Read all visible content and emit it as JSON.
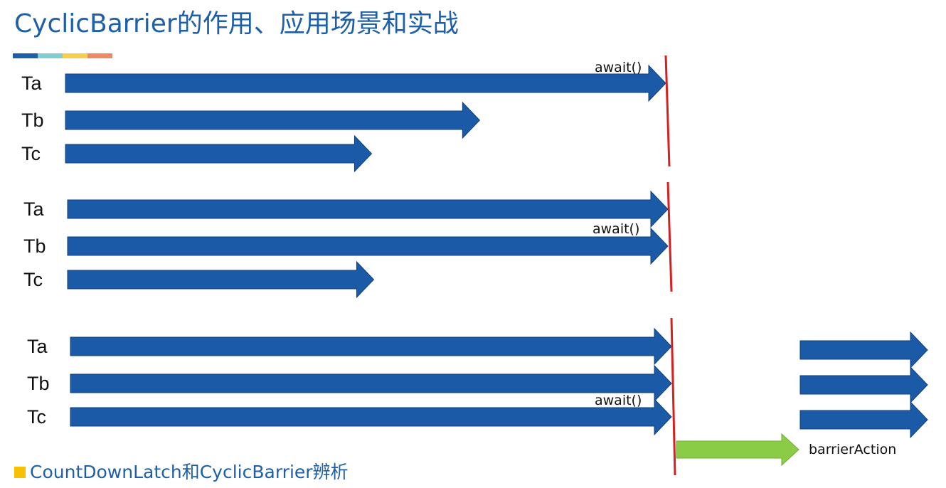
{
  "title": "CyclicBarrier的作用、应用场景和实战",
  "accent_colors": [
    "#1d5fa8",
    "#7fcfd0",
    "#f6cf4a",
    "#f08765"
  ],
  "colors": {
    "thread_arrow": "#1b5aa6",
    "thread_arrow_edge": "#0f3f7e",
    "barrier_line": "#d62020",
    "action_arrow": "#8bcc47",
    "bullet": "#f6c000"
  },
  "panels": [
    {
      "threads": [
        {
          "label": "Ta",
          "progress": 1.0
        },
        {
          "label": "Tb",
          "progress": 0.69
        },
        {
          "label": "Tc",
          "progress": 0.51
        }
      ],
      "await_label": "await()",
      "await_row": 0
    },
    {
      "threads": [
        {
          "label": "Ta",
          "progress": 1.0
        },
        {
          "label": "Tb",
          "progress": 1.0
        },
        {
          "label": "Tc",
          "progress": 0.51
        }
      ],
      "await_label": "await()",
      "await_row": 1
    },
    {
      "threads": [
        {
          "label": "Ta",
          "progress": 1.0
        },
        {
          "label": "Tb",
          "progress": 1.0
        },
        {
          "label": "Tc",
          "progress": 1.0
        }
      ],
      "await_label": "await()",
      "await_row": 2,
      "barrier_action": "barrierAction",
      "continue_threads": 3
    }
  ],
  "footer": {
    "bullet_icon": "square-bullet-icon",
    "text": "CountDownLatch和CyclicBarrier辨析"
  }
}
